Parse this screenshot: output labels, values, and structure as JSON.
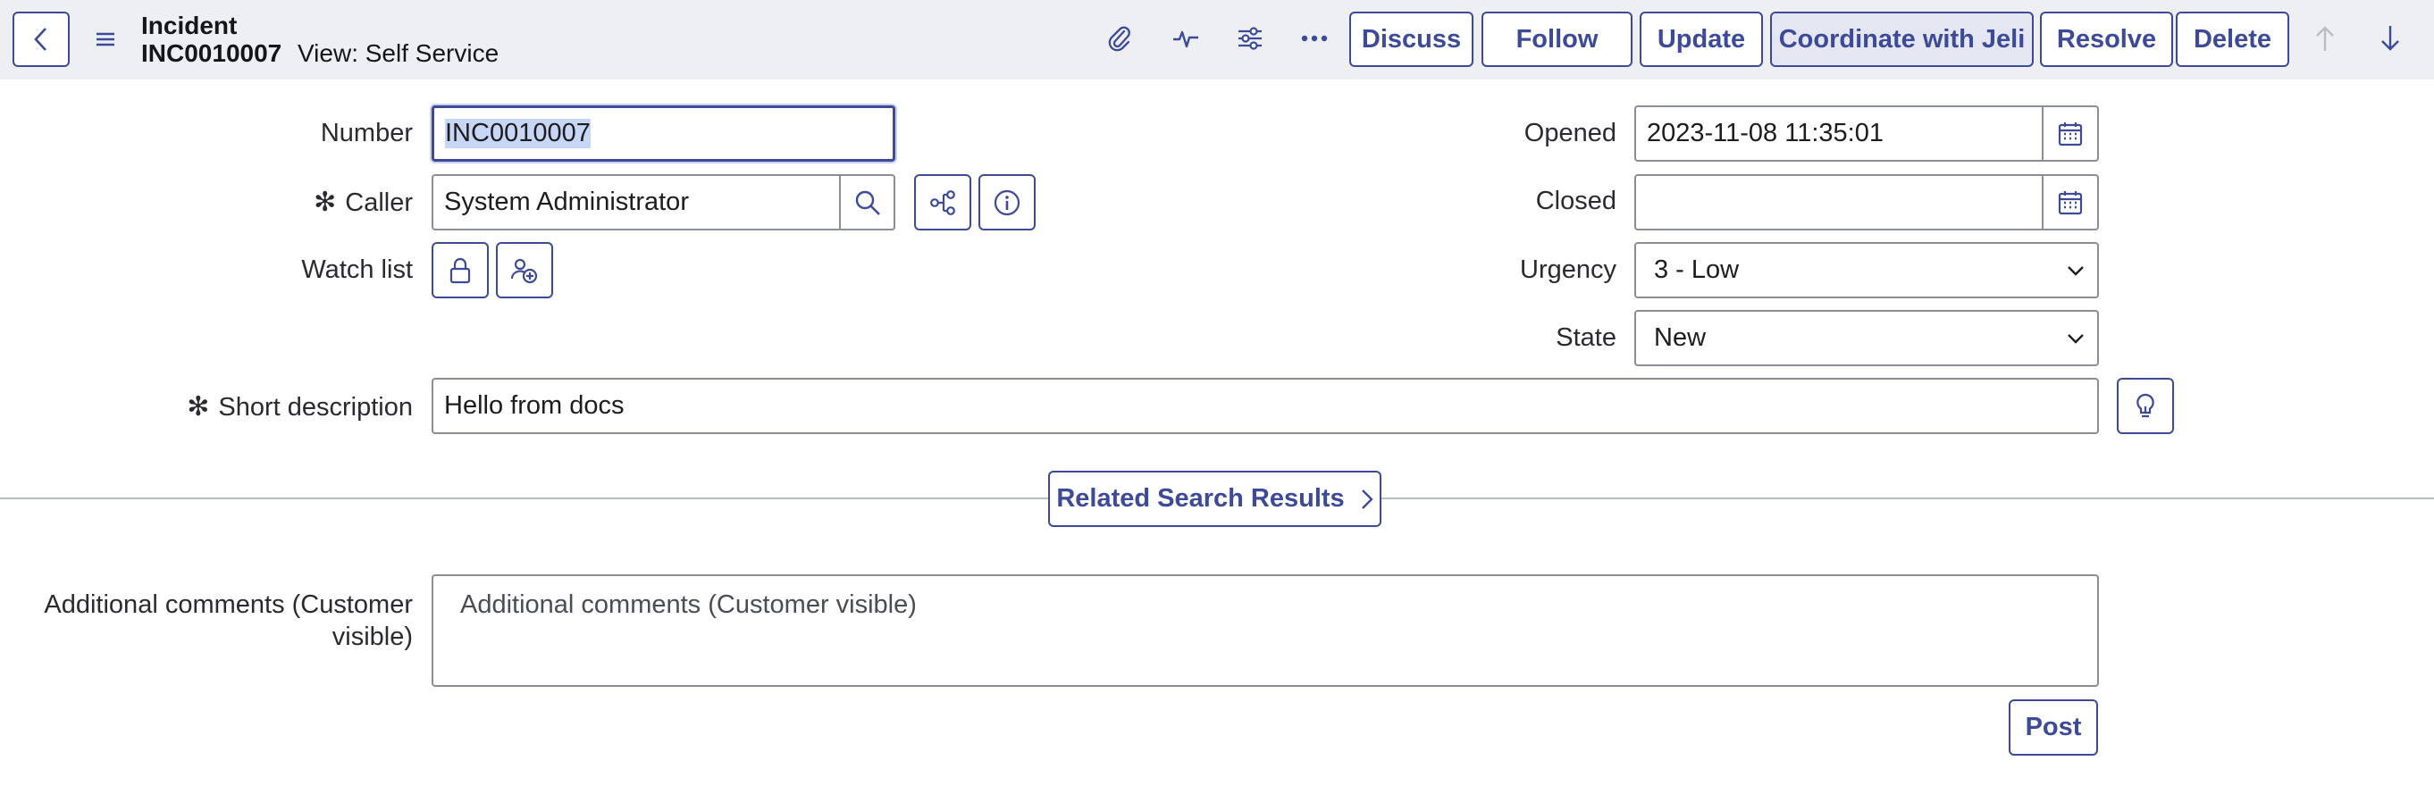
{
  "header": {
    "record_type": "Incident",
    "record_number": "INC0010007",
    "view_label": "View: Self Service",
    "icons": [
      "back-icon",
      "menu-icon",
      "attachment-icon",
      "activity-icon",
      "settings-icon",
      "more-icon",
      "up-arrow-icon",
      "down-arrow-icon"
    ],
    "buttons": {
      "discuss": "Discuss",
      "follow": "Follow",
      "update": "Update",
      "coordinate": "Coordinate with Jeli",
      "resolve": "Resolve",
      "delete": "Delete"
    }
  },
  "form": {
    "number": {
      "label": "Number",
      "value": "INC0010007"
    },
    "caller": {
      "label": "Caller",
      "value": "System Administrator",
      "required_mark": "✻"
    },
    "watch_list": {
      "label": "Watch list"
    },
    "opened": {
      "label": "Opened",
      "value": "2023-11-08 11:35:01"
    },
    "closed": {
      "label": "Closed",
      "value": ""
    },
    "urgency": {
      "label": "Urgency",
      "value": "3 - Low"
    },
    "state": {
      "label": "State",
      "value": "New"
    },
    "short_description": {
      "label": "Short description",
      "value": "Hello from docs",
      "required_mark": "✻"
    },
    "related_search": "Related Search Results",
    "additional_comments": {
      "label_line1": "Additional comments (Customer",
      "label_line2": "visible)",
      "placeholder": "Additional comments (Customer visible)"
    },
    "post_button": "Post"
  },
  "colors": {
    "accent": "#3d4a9a",
    "header_bg": "#eeeff2",
    "selection": "#c8d6f5"
  }
}
